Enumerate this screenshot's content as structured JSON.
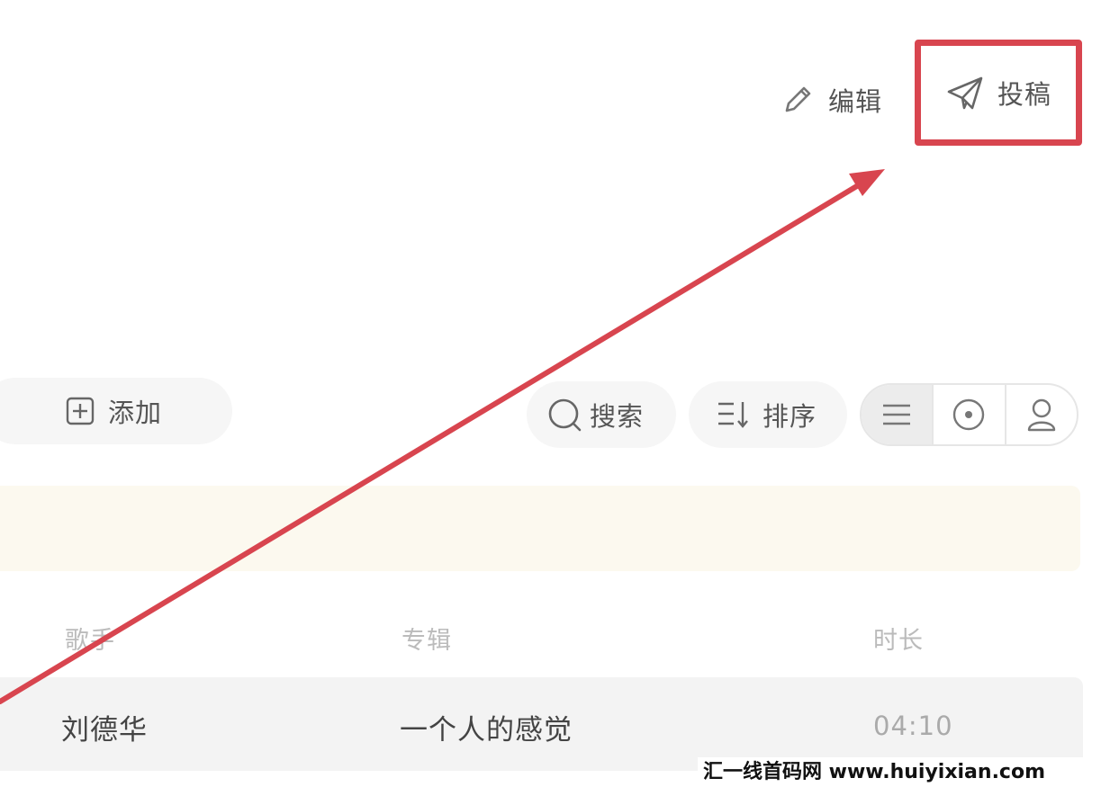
{
  "header": {
    "edit_label": "编辑",
    "submit_label": "投稿"
  },
  "toolbar": {
    "add_label": "添加",
    "search_label": "搜索",
    "sort_label": "排序",
    "view_modes": [
      "list-icon",
      "disc-icon",
      "person-icon"
    ]
  },
  "table": {
    "columns": [
      "歌手",
      "专辑",
      "时长"
    ],
    "rows": [
      {
        "artist": "刘德华",
        "album": "一个人的感觉",
        "duration": "04:10"
      }
    ]
  },
  "watermark": "汇一线首码网 www.huiyixian.com",
  "colors": {
    "highlight": "#d8454f",
    "banner": "#fcf9ef",
    "row_bg": "#f3f3f3"
  }
}
